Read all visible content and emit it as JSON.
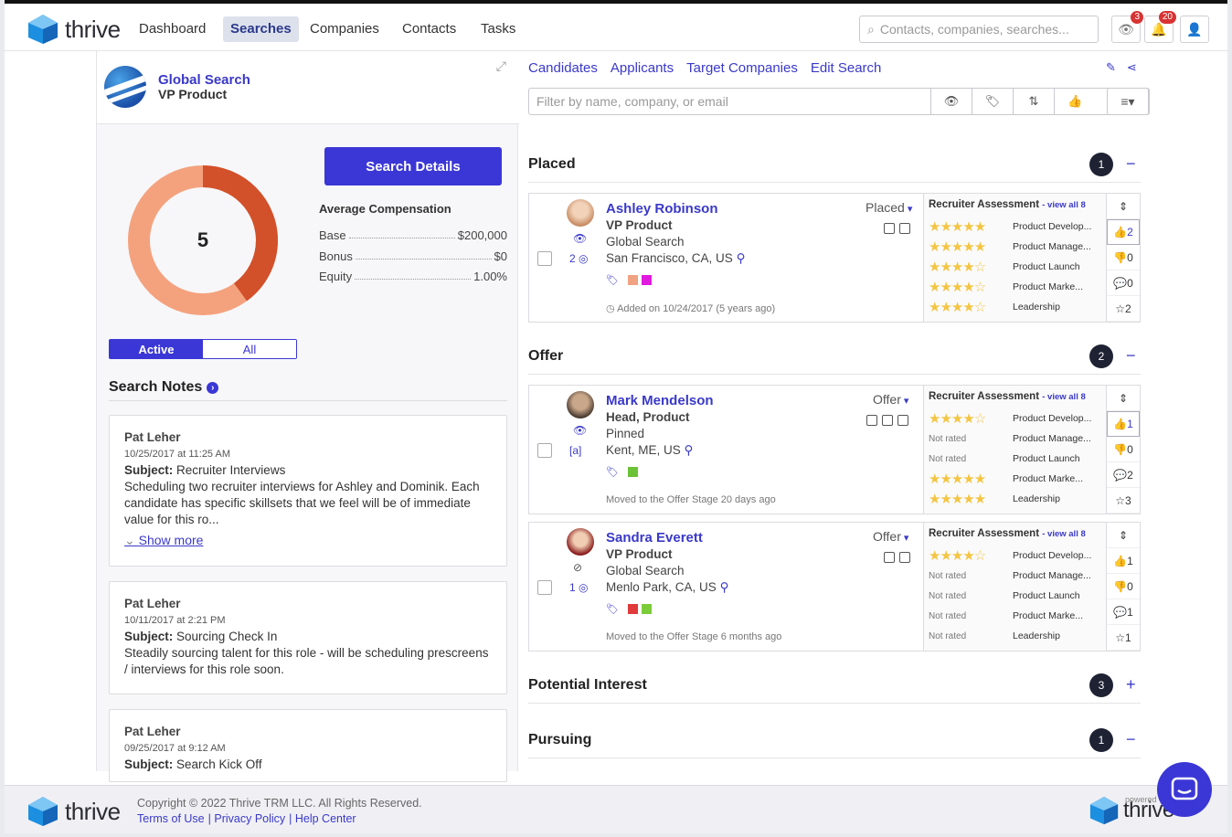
{
  "nav": {
    "brand": "thrive",
    "items": [
      {
        "label": "Dashboard",
        "active": false
      },
      {
        "label": "Searches",
        "active": true
      },
      {
        "label": "Companies",
        "active": false
      },
      {
        "label": "Contacts",
        "active": false
      },
      {
        "label": "Tasks",
        "active": false
      }
    ],
    "search_placeholder": "Contacts, companies, searches...",
    "watch_badge": "3",
    "notif_badge": "20"
  },
  "search": {
    "title": "Global Search",
    "subtitle": "VP Product",
    "count": "5",
    "details_button": "Search Details",
    "comp_title": "Average Compensation",
    "comp": [
      {
        "label": "Base",
        "value": "$200,000"
      },
      {
        "label": "Bonus",
        "value": "$0"
      },
      {
        "label": "Equity",
        "value": "1.00%"
      }
    ],
    "toggle_active": "Active",
    "toggle_all": "All",
    "donut_segments": [
      0.4,
      0.6
    ]
  },
  "notes": {
    "title": "Search Notes",
    "items": [
      {
        "author": "Pat Leher",
        "date": "10/25/2017 at 11:25 AM",
        "subject_label": "Subject:",
        "subject": "Recruiter Interviews",
        "body": "Scheduling two recruiter interviews for Ashley and Dominik. Each candidate has specific skillsets that we feel will be of immediate value for this ro...",
        "more": "Show more"
      },
      {
        "author": "Pat Leher",
        "date": "10/11/2017 at 2:21 PM",
        "subject_label": "Subject:",
        "subject": "Sourcing Check In",
        "body": "Steadily sourcing talent for this role - will be scheduling prescreens / interviews for this role soon."
      },
      {
        "author": "Pat Leher",
        "date": "09/25/2017 at 9:12 AM",
        "subject_label": "Subject:",
        "subject": "Search Kick Off"
      }
    ]
  },
  "tabs": [
    "Candidates",
    "Applicants",
    "Target Companies",
    "Edit Search"
  ],
  "filter_placeholder": "Filter by name, company, or email",
  "stages": [
    {
      "name": "Placed",
      "count": "1",
      "toggle": "−"
    },
    {
      "name": "Offer",
      "count": "2",
      "toggle": "−"
    },
    {
      "name": "Potential Interest",
      "count": "3",
      "toggle": "+"
    },
    {
      "name": "Pursuing",
      "count": "1",
      "toggle": "−"
    }
  ],
  "assessment_label": "Recruiter Assessment",
  "view_all": "- view all 8",
  "candidates": [
    {
      "name": "Ashley Robinson",
      "title": "VP Product",
      "line3": "Global Search",
      "location": "San Francisco, CA, US",
      "stage": "Placed",
      "meta": "2 ◎",
      "footer": "Added on 10/24/2017 (5 years ago)",
      "tag_colors": [
        "#f0a283",
        "#e01adf"
      ],
      "ratings": [
        {
          "stars": "★★★★★",
          "crit": "Product Develop..."
        },
        {
          "stars": "★★★★★",
          "crit": "Product Manage..."
        },
        {
          "stars": "★★★★☆",
          "crit": "Product Launch"
        },
        {
          "stars": "★★★★☆",
          "crit": "Product Marke..."
        },
        {
          "stars": "★★★★☆",
          "crit": "Leadership"
        }
      ],
      "side": [
        "⇕",
        "👍2",
        "👎0",
        "💬0",
        "☆2"
      ]
    },
    {
      "name": "Mark Mendelson",
      "title": "Head, Product",
      "line3": "Pinned",
      "location": "Kent, ME, US",
      "stage": "Offer",
      "meta": "[a]",
      "footer": "Moved to the Offer Stage 20 days ago",
      "tag_colors": [
        "#6cc237"
      ],
      "ratings": [
        {
          "stars": "★★★★☆",
          "crit": "Product Develop..."
        },
        {
          "stars": "Not rated",
          "crit": "Product Manage..."
        },
        {
          "stars": "Not rated",
          "crit": "Product Launch"
        },
        {
          "stars": "★★★★★",
          "crit": "Product Marke..."
        },
        {
          "stars": "★★★★★",
          "crit": "Leadership"
        }
      ],
      "side": [
        "⇕",
        "👍1",
        "👎0",
        "💬2",
        "☆3"
      ]
    },
    {
      "name": "Sandra Everett",
      "title": "VP Product",
      "line3": "Global Search",
      "location": "Menlo Park, CA, US",
      "stage": "Offer",
      "meta": "1 ◎",
      "footer": "Moved to the Offer Stage 6 months ago",
      "tag_colors": [
        "#e03a3a",
        "#7ccc3a"
      ],
      "ratings": [
        {
          "stars": "★★★★☆",
          "crit": "Product Develop..."
        },
        {
          "stars": "Not rated",
          "crit": "Product Manage..."
        },
        {
          "stars": "Not rated",
          "crit": "Product Launch"
        },
        {
          "stars": "Not rated",
          "crit": "Product Marke..."
        },
        {
          "stars": "Not rated",
          "crit": "Leadership"
        }
      ],
      "side": [
        "⇕",
        "👍1",
        "👎0",
        "💬1",
        "☆1"
      ]
    }
  ],
  "footer": {
    "brand": "thrive",
    "copyright": "Copyright © 2022 Thrive TRM LLC. All Rights Reserved.",
    "links": [
      "Terms of Use",
      "| Privacy Policy",
      "| Help Center"
    ],
    "powered": "powered"
  }
}
